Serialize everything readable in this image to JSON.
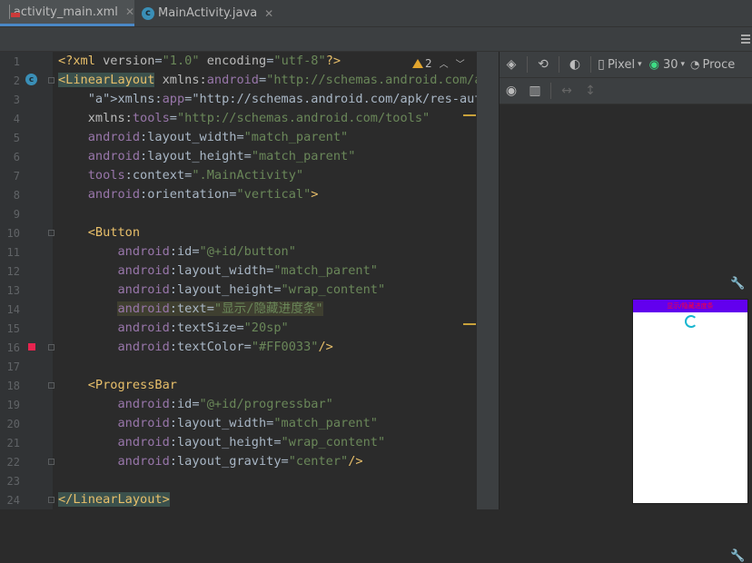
{
  "tabs": [
    {
      "label": "activity_main.xml",
      "icon": "xml-file-icon",
      "active": true
    },
    {
      "label": "MainActivity.java",
      "icon": "java-class-icon",
      "active": false
    }
  ],
  "editor": {
    "line_numbers": [
      "1",
      "2",
      "3",
      "4",
      "5",
      "6",
      "7",
      "8",
      "9",
      "10",
      "11",
      "12",
      "13",
      "14",
      "15",
      "16",
      "17",
      "18",
      "19",
      "20",
      "21",
      "22",
      "23",
      "24"
    ],
    "warnings_count": "2",
    "lines": [
      "<?xml version=\"1.0\" encoding=\"utf-8\"?>",
      "<LinearLayout xmlns:android=\"http://schemas.android.com/ap",
      "    xmlns:app=\"http://schemas.android.com/apk/res-auto\"",
      "    xmlns:tools=\"http://schemas.android.com/tools\"",
      "    android:layout_width=\"match_parent\"",
      "    android:layout_height=\"match_parent\"",
      "    tools:context=\".MainActivity\"",
      "    android:orientation=\"vertical\">",
      "",
      "    <Button",
      "        android:id=\"@+id/button\"",
      "        android:layout_width=\"match_parent\"",
      "        android:layout_height=\"wrap_content\"",
      "        android:text=\"显示/隐藏进度条\"",
      "        android:textSize=\"20sp\"",
      "        android:textColor=\"#FF0033\"/>",
      "",
      "    <ProgressBar",
      "        android:id=\"@+id/progressbar\"",
      "        android:layout_width=\"match_parent\"",
      "        android:layout_height=\"wrap_content\"",
      "        android:layout_gravity=\"center\"/>",
      "",
      "</LinearLayout>"
    ]
  },
  "design_toolbar": {
    "device": "Pixel",
    "api_level": "30",
    "theme_label": "Proce"
  },
  "preview": {
    "button_text": "显示/隐藏进度条",
    "button_text_color": "#FF0033",
    "app_bar_color": "#6200EE",
    "spinner_color": "#18B6D0"
  }
}
